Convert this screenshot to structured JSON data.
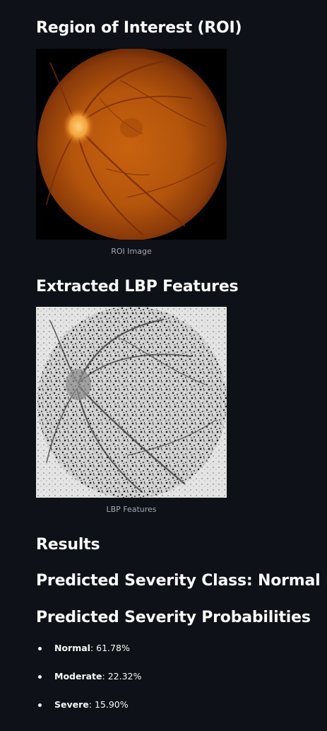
{
  "roi_section": {
    "title": "Region of Interest (ROI)",
    "caption": "ROI Image"
  },
  "lbp_section": {
    "title": "Extracted LBP Features",
    "caption": "LBP Features"
  },
  "results": {
    "title": "Results",
    "predicted_class": "Predicted Severity Class: Normal",
    "probabilities_title": "Predicted Severity Probabilities",
    "probabilities": [
      {
        "label": "Normal",
        "value": "61.78%"
      },
      {
        "label": "Moderate",
        "value": "22.32%"
      },
      {
        "label": "Severe",
        "value": "15.90%"
      }
    ]
  },
  "colors": {
    "background": "#0e1117",
    "text": "#fafafa",
    "caption": "#a3a8b4"
  }
}
